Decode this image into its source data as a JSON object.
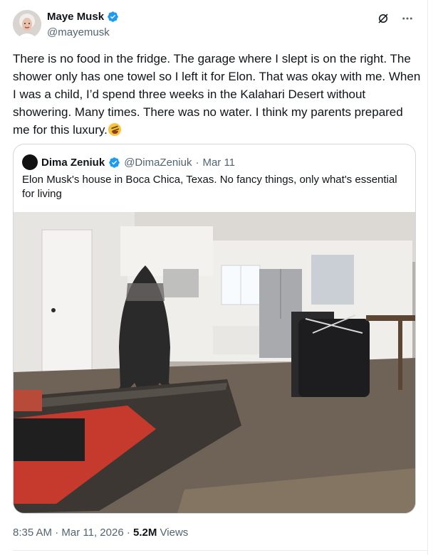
{
  "author": {
    "name": "Maye Musk",
    "handle": "@mayemusk"
  },
  "tweet": {
    "text": "There is no food in the fridge. The garage where I slept is on the right. The shower only has one towel so I left it for Elon. That was okay with me. When I was a child, I’d spend three weeks in the Kalahari Desert without showering. Many times. There was no water. I think my parents prepared me for this luxury.",
    "emoji": "rolling-on-floor-laughing"
  },
  "quote": {
    "name": "Dima Zeniuk",
    "handle": "@DimaZeniuk",
    "sep": "·",
    "date": "Mar 11",
    "text": "Elon Musk's house in Boca Chica, Texas. No fancy things, only what's essential for living"
  },
  "meta": {
    "time": "8:35 AM",
    "sep1": "·",
    "date": "Mar 11, 2026",
    "sep2": "·",
    "views_count": "5.2M",
    "views_label": "Views"
  },
  "colors": {
    "accent": "#1d9bf0",
    "muted": "#536471",
    "text": "#0f1419",
    "border": "#cfd9de"
  },
  "icons": [
    "verified-badge-icon",
    "grok-icon",
    "more-icon"
  ]
}
